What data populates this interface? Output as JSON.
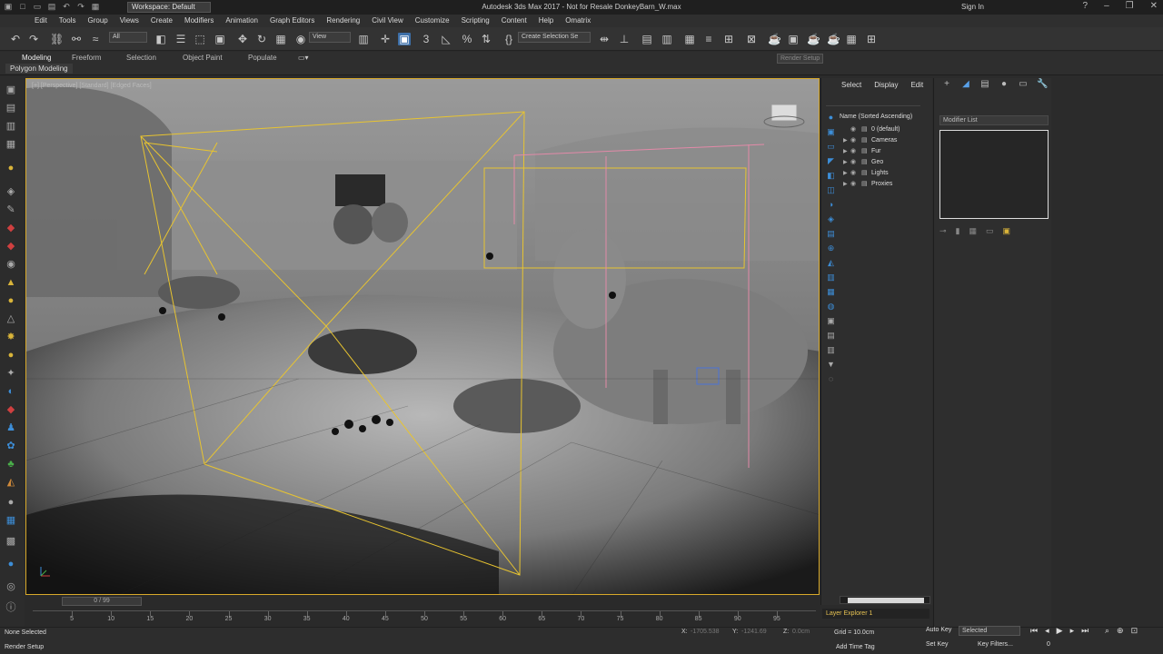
{
  "titlebar": {
    "workspace": "Workspace: Default",
    "title": "Autodesk 3ds Max 2017 - Not for Resale   DonkeyBarn_W.max",
    "sign_in": "Sign In"
  },
  "menu": [
    "Edit",
    "Tools",
    "Group",
    "Views",
    "Create",
    "Modifiers",
    "Animation",
    "Graph Editors",
    "Rendering",
    "Civil View",
    "Customize",
    "Scripting",
    "Content",
    "Help",
    "Omatrix"
  ],
  "toolbar": {
    "filter": "All",
    "ref_coord": "View",
    "selection_set": "Create Selection Se",
    "tooltip": "Render Setup"
  },
  "ribbon": {
    "tabs": [
      "Modeling",
      "Freeform",
      "Selection",
      "Object Paint",
      "Populate"
    ],
    "active_tab": "Modeling",
    "sub_label": "Polygon Modeling"
  },
  "viewport": {
    "label": "[+] [Perspective] [Standard] [Edged Faces]"
  },
  "scene_explorer": {
    "tabs": [
      "Select",
      "Display",
      "Edit"
    ],
    "column_header": "Name (Sorted Ascending)",
    "items": [
      {
        "name": "0 (default)",
        "expanded": false
      },
      {
        "name": "Cameras",
        "expanded": false
      },
      {
        "name": "Fur",
        "expanded": false
      },
      {
        "name": "Geo",
        "expanded": false
      },
      {
        "name": "Lights",
        "expanded": false
      },
      {
        "name": "Proxies",
        "expanded": false
      }
    ],
    "footer": "Layer Explorer 1"
  },
  "command_panel": {
    "modifier_list": "Modifier List"
  },
  "timeline": {
    "frame_range": "0 / 99",
    "ticks": [
      5,
      10,
      15,
      20,
      25,
      30,
      35,
      40,
      45,
      50,
      55,
      60,
      65,
      70,
      75,
      80,
      85,
      90,
      95
    ]
  },
  "status": {
    "selection": "None Selected",
    "prompt": "Render Setup",
    "x_label": "X:",
    "x_value": "-1705.538",
    "y_label": "Y:",
    "y_value": "-1241.69",
    "z_label": "Z:",
    "z_value": "0.0cm",
    "grid": "Grid = 10.0cm",
    "add_time_tag": "Add Time Tag",
    "auto_key": "Auto Key",
    "set_key": "Set Key",
    "key_mode": "Selected",
    "key_filters": "Key Filters...",
    "frame": "0"
  },
  "colors": {
    "accent": "#3d6fa8",
    "viewport_border": "#d8a92a",
    "camera_frustum": "#e8c430",
    "layer_explorer_text": "#e6c252"
  }
}
